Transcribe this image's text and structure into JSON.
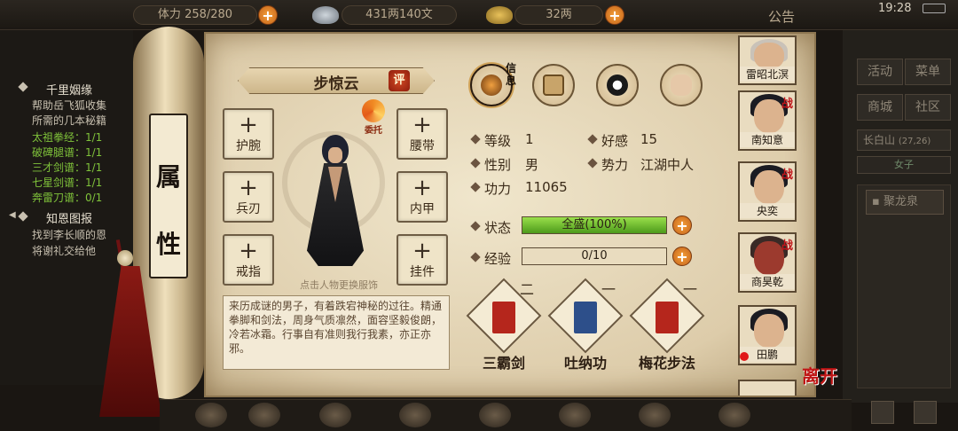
{
  "topbar": {
    "stamina": "258/280",
    "stamina_prefix": "体力",
    "money": "431两140文",
    "gold": "32两",
    "notice": "公告",
    "time": "19:28"
  },
  "quest": {
    "title1": "千里姻缘",
    "desc1": "帮助岳飞狐收集",
    "desc2": "所需的几本秘籍",
    "items": [
      "太祖拳经：1/1",
      "破碑腿谱：1/1",
      "三才剑谱：1/1",
      "七星剑谱：1/1",
      "奔雷刀谱：0/1"
    ],
    "title2": "知恩图报",
    "desc3": "找到李长顺的恩",
    "desc4": "将谢礼交给他"
  },
  "right_menu": {
    "activity": "活动",
    "menu": "菜单",
    "shop": "商城",
    "community": "社区",
    "location": "长白山",
    "coords": "(27,26)",
    "channel": "女子",
    "place": "聚龙泉"
  },
  "scroll_tag": {
    "c1": "属",
    "c2": "性"
  },
  "character": {
    "name": "步惊云",
    "rate": "评",
    "entrust": "委托",
    "outfit_hint": "点击人物更换服饰",
    "bio": "来历成谜的男子，有着跌宕神秘的过往。精通拳脚和剑法，周身气质凛然，面容坚毅俊朗，冷若冰霜。行事自有准则我行我素，亦正亦邪。"
  },
  "slots": {
    "wrist": "护腕",
    "belt": "腰带",
    "weapon": "兵刃",
    "armor": "内甲",
    "ring": "戒指",
    "pendant": "挂件",
    "plus": "+"
  },
  "tabs": {
    "info": "信息"
  },
  "stats": {
    "level_label": "等级",
    "level": "1",
    "favor_label": "好感",
    "favor": "15",
    "gender_label": "性别",
    "gender": "男",
    "faction_label": "势力",
    "faction": "江湖中人",
    "power_label": "功力",
    "power": "11065",
    "status_label": "状态",
    "status": "全盛(100%)",
    "status_fraction": 1.0,
    "exp_label": "经验",
    "exp": "0/10",
    "exp_fraction": 0.0,
    "plus": "+"
  },
  "skills": [
    {
      "name": "三霸剑",
      "rank": "二",
      "color": "#b5261c"
    },
    {
      "name": "吐纳功",
      "rank": "一",
      "color": "#2d4f8a"
    },
    {
      "name": "梅花步法",
      "rank": "一",
      "color": "#b5261c"
    }
  ],
  "party": [
    {
      "name": "雷昭北溟",
      "war": ""
    },
    {
      "name": "南知意",
      "war": "战"
    },
    {
      "name": "央奕",
      "war": "战"
    },
    {
      "name": "商昊乾",
      "war": "战"
    },
    {
      "name": "田鹏",
      "war": ""
    }
  ],
  "leave": "离开"
}
